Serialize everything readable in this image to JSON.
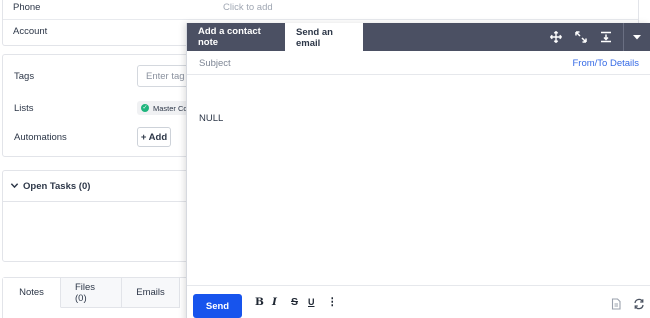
{
  "contact": {
    "rows": [
      {
        "label": "Phone",
        "value": "Click to add"
      },
      {
        "label": "Account",
        "value": ""
      }
    ]
  },
  "details": {
    "tags_label": "Tags",
    "tags_placeholder": "Enter tag",
    "lists_label": "Lists",
    "list_chip": "Master Co",
    "automations_label": "Automations",
    "add_button": "+ Add"
  },
  "tasks": {
    "title": "Open Tasks (0)"
  },
  "bottom_tabs": [
    {
      "label": "Notes"
    },
    {
      "label": "Files (0)"
    },
    {
      "label": "Emails"
    }
  ],
  "dialog": {
    "tabs": [
      {
        "label": "Add a contact note"
      },
      {
        "label": "Send an email"
      }
    ],
    "header_icons": [
      "move-icon",
      "expand-icon",
      "minimize-icon",
      "caret-down-icon"
    ],
    "subject_label": "Subject",
    "from_to_link": "From/To Details",
    "body": "NULL",
    "send_button": "Send",
    "format": {
      "bold": "B",
      "italic": "I",
      "strike": "S",
      "underline": "U",
      "more": "⋮"
    },
    "footer_icons": [
      "document-icon",
      "sync-icon"
    ]
  },
  "colors": {
    "header_bg": "#4b5063",
    "send_button": "#1754ed",
    "link": "#356ae6",
    "list_dot": "#1fb57d"
  }
}
